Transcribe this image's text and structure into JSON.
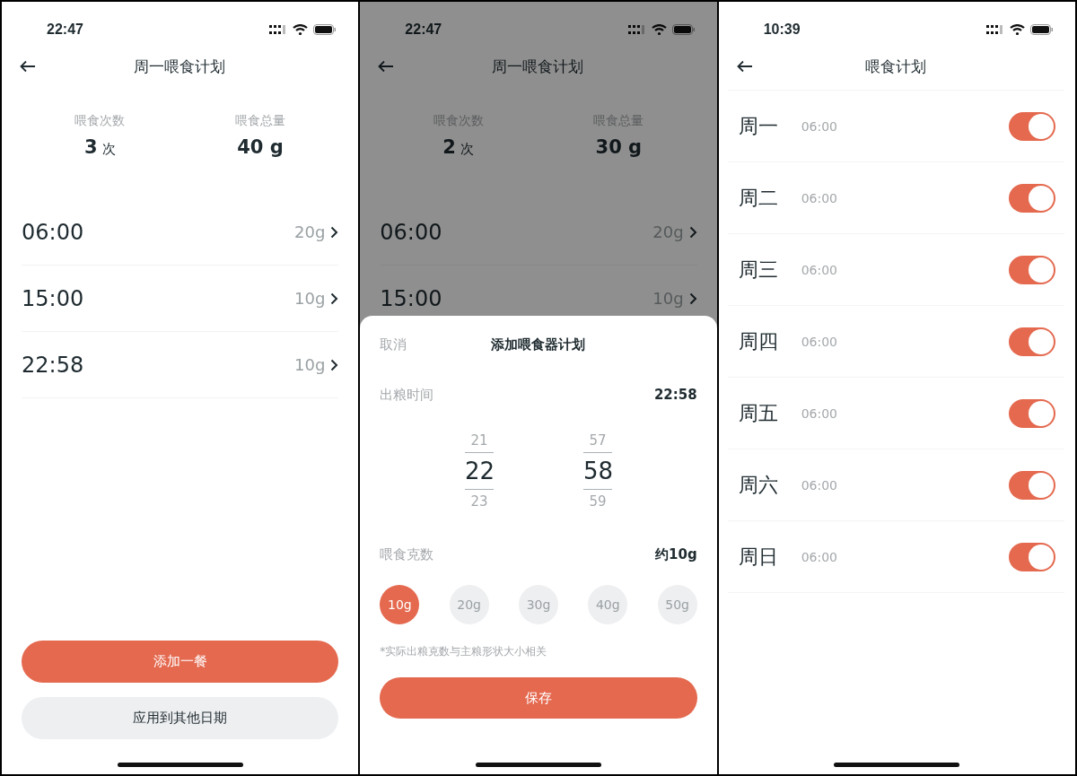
{
  "plan_screen": {
    "status_time": "22:47",
    "title": "周一喂食计划",
    "stats": [
      {
        "label": "喂食次数",
        "value": "3",
        "unit": "次"
      },
      {
        "label": "喂食总量",
        "value": "40 g"
      }
    ],
    "meals": [
      {
        "time": "06:00",
        "amount": "20g"
      },
      {
        "time": "15:00",
        "amount": "10g"
      },
      {
        "time": "22:58",
        "amount": "10g"
      }
    ],
    "buttons": [
      {
        "label": "添加一餐",
        "kind": "primary"
      },
      {
        "label": "应用到其他日期",
        "kind": "secondary"
      }
    ]
  },
  "dialog_screen": {
    "status_time": "22:47",
    "title": "周一喂食计划",
    "stats": [
      {
        "label": "喂食次数",
        "value": "2",
        "unit": "次"
      },
      {
        "label": "喂食总量",
        "value": "30 g"
      }
    ],
    "meals": [
      {
        "time": "06:00",
        "amount": "20g"
      },
      {
        "time": "15:00",
        "amount": "10g"
      }
    ],
    "sheet": {
      "cancel": "取消",
      "title": "添加喂食器计划",
      "time_label": "出粮时间",
      "time_value": "22:58",
      "picker": [
        {
          "above": "21",
          "value": "22",
          "below": "23"
        },
        {
          "above": "57",
          "value": "58",
          "below": "59"
        }
      ],
      "amount_label": "喂食克数",
      "amount_value": "约10g",
      "options": [
        {
          "label": "10g",
          "selected": true
        },
        {
          "label": "20g",
          "selected": false
        },
        {
          "label": "30g",
          "selected": false
        },
        {
          "label": "40g",
          "selected": false
        },
        {
          "label": "50g",
          "selected": false
        }
      ],
      "note": "*实际出粮克数与主粮形状大小相关",
      "save": "保存"
    }
  },
  "week_screen": {
    "status_time": "10:39",
    "title": "喂食计划",
    "days": [
      {
        "day": "周一",
        "time": "06:00",
        "on": true
      },
      {
        "day": "周二",
        "time": "06:00",
        "on": true
      },
      {
        "day": "周三",
        "time": "06:00",
        "on": true
      },
      {
        "day": "周四",
        "time": "06:00",
        "on": true
      },
      {
        "day": "周五",
        "time": "06:00",
        "on": true
      },
      {
        "day": "周六",
        "time": "06:00",
        "on": true
      },
      {
        "day": "周日",
        "time": "06:00",
        "on": true
      }
    ]
  }
}
